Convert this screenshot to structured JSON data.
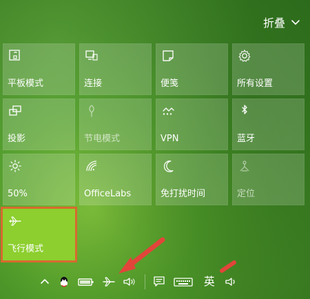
{
  "header": {
    "collapse_label": "折叠"
  },
  "tiles": [
    {
      "id": "tablet",
      "label": "平板模式",
      "icon": "tablet-mode-icon",
      "state": "normal"
    },
    {
      "id": "connect",
      "label": "连接",
      "icon": "connect-icon",
      "state": "normal"
    },
    {
      "id": "notes",
      "label": "便笺",
      "icon": "note-icon",
      "state": "normal"
    },
    {
      "id": "settings",
      "label": "所有设置",
      "icon": "gear-icon",
      "state": "normal"
    },
    {
      "id": "project",
      "label": "投影",
      "icon": "project-icon",
      "state": "normal"
    },
    {
      "id": "battery_saver",
      "label": "节电模式",
      "icon": "battery-saver-icon",
      "state": "disabled"
    },
    {
      "id": "vpn",
      "label": "VPN",
      "icon": "vpn-icon",
      "state": "normal"
    },
    {
      "id": "bluetooth",
      "label": "蓝牙",
      "icon": "bluetooth-icon",
      "state": "normal"
    },
    {
      "id": "brightness",
      "label": "50%",
      "icon": "brightness-icon",
      "state": "normal"
    },
    {
      "id": "wifi",
      "label": "OfficeLabs",
      "icon": "wifi-icon",
      "state": "normal"
    },
    {
      "id": "quiet",
      "label": "免打扰时间",
      "icon": "moon-icon",
      "state": "normal"
    },
    {
      "id": "location",
      "label": "定位",
      "icon": "location-icon",
      "state": "disabled"
    },
    {
      "id": "airplane",
      "label": "飞行模式",
      "icon": "airplane-icon",
      "state": "active"
    }
  ],
  "taskbar": {
    "ime_label": "英"
  },
  "colors": {
    "active_tile": "#8ccf2e",
    "active_outline": "#d86a2f",
    "annotation_red": "#e2453a"
  }
}
